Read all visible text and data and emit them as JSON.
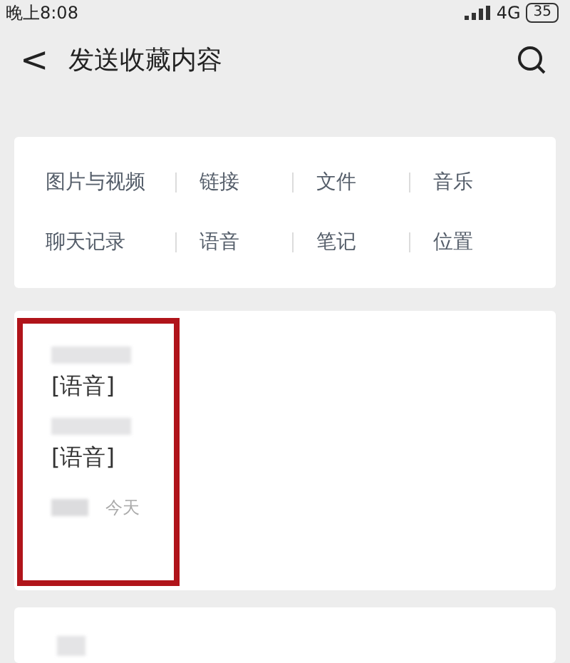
{
  "status_bar": {
    "time": "晚上8:08",
    "network": "4G",
    "battery": "35"
  },
  "header": {
    "back": "<",
    "title": "发送收藏内容"
  },
  "categories": [
    {
      "label": "图片与视频"
    },
    {
      "label": "链接"
    },
    {
      "label": "文件"
    },
    {
      "label": "音乐"
    },
    {
      "label": "聊天记录"
    },
    {
      "label": "语音"
    },
    {
      "label": "笔记"
    },
    {
      "label": "位置"
    }
  ],
  "favorites": [
    {
      "lines": [
        "[语音]",
        "[语音]"
      ],
      "time": "今天",
      "highlighted": true
    }
  ]
}
